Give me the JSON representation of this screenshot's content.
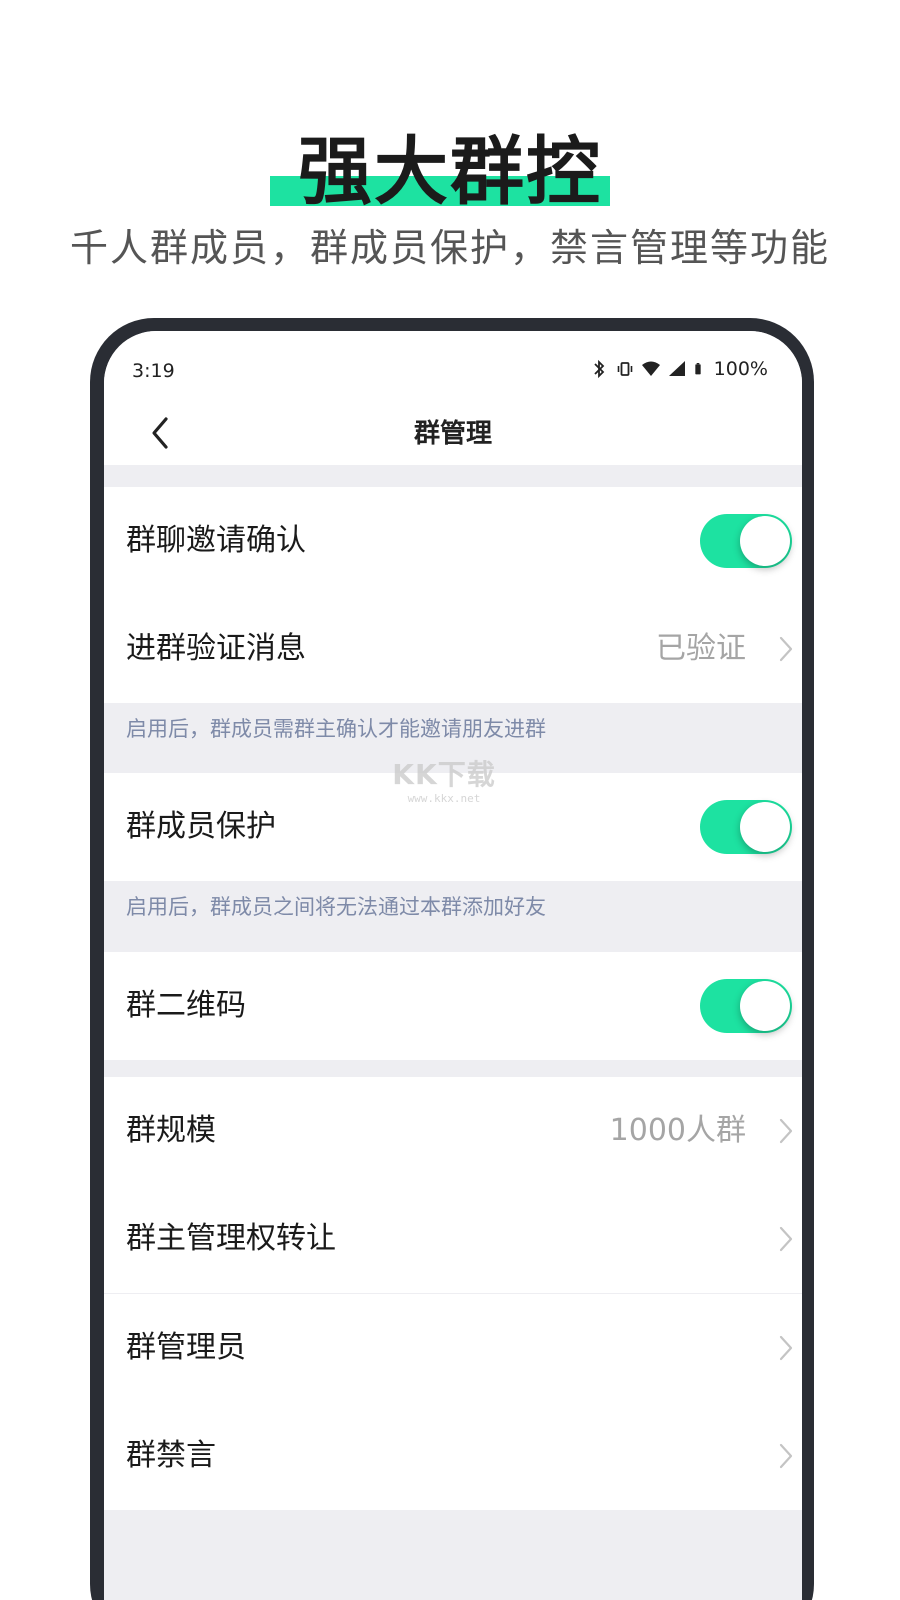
{
  "hero": {
    "title": "强大群控",
    "subtitle": "千人群成员，群成员保护，禁言管理等功能",
    "highlight_color": "#1de2a1"
  },
  "status_bar": {
    "time": "3:19",
    "battery": "100%",
    "icons": [
      "bluetooth-icon",
      "vibrate-icon",
      "wifi-icon",
      "signal-icon",
      "battery-icon"
    ]
  },
  "nav": {
    "title": "群管理",
    "back_icon": "chevron-left-icon"
  },
  "settings": {
    "invite_confirm": {
      "label": "群聊邀请确认",
      "toggle_on": true
    },
    "join_verify": {
      "label": "进群验证消息",
      "value": "已验证"
    },
    "invite_hint": "启用后，群成员需群主确认才能邀请朋友进群",
    "member_protect": {
      "label": "群成员保护",
      "toggle_on": true
    },
    "protect_hint": "启用后，群成员之间将无法通过本群添加好友",
    "qr_code": {
      "label": "群二维码",
      "toggle_on": true
    },
    "group_size": {
      "label": "群规模",
      "value": "1000人群"
    },
    "transfer_owner": {
      "label": "群主管理权转让"
    },
    "admins": {
      "label": "群管理员"
    },
    "mute_all": {
      "label": "群禁言"
    }
  },
  "watermark": {
    "main": "KK下载",
    "sub": "www.kkx.net"
  },
  "colors": {
    "accent": "#1de2a1",
    "hint_text": "#7e8aa8",
    "value_text": "#a5a5a5",
    "section_bg": "#eeeef2",
    "phone_frame": "#2a2d34"
  }
}
